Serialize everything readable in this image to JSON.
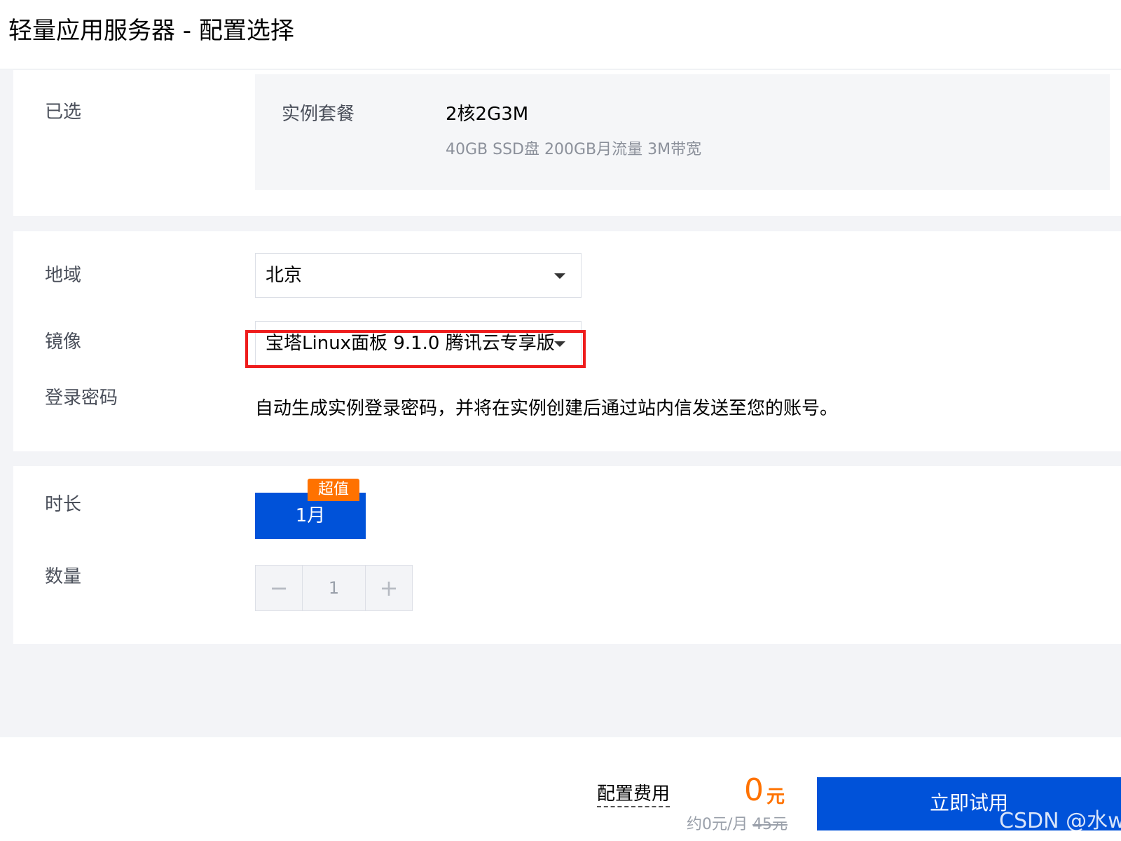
{
  "header": {
    "title": "轻量应用服务器 - 配置选择"
  },
  "selected": {
    "label": "已选",
    "package_label": "实例套餐",
    "package_name": "2核2G3M",
    "package_desc": "40GB SSD盘 200GB月流量 3M带宽"
  },
  "config": {
    "region_label": "地域",
    "region_value": "北京",
    "image_label": "镜像",
    "image_value": "宝塔Linux面板 9.1.0 腾讯云专享版",
    "password_label": "登录密码",
    "password_text": "自动生成实例登录密码，并将在实例创建后通过站内信发送至您的账号。"
  },
  "purchase": {
    "duration_label": "时长",
    "duration_value": "1月",
    "promo_badge": "超值",
    "quantity_label": "数量",
    "quantity_value": "1",
    "minus_symbol": "−",
    "plus_symbol": "+"
  },
  "footer": {
    "cost_label": "配置费用",
    "price_amount": "0",
    "price_unit": "元",
    "monthly_price": "约0元/月",
    "original_price": "45元",
    "cta_label": "立即试用"
  },
  "watermark": "CSDN @水w",
  "colors": {
    "accent": "#0052d9",
    "promo": "#ff7200",
    "highlight": "#ee1c1c"
  },
  "icons": {
    "region_caret": "caret-down-icon",
    "image_caret": "caret-down-icon"
  }
}
